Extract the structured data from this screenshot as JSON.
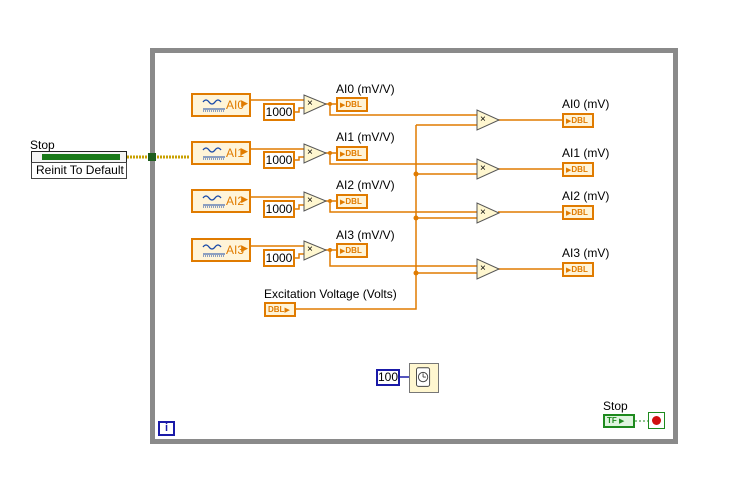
{
  "stop_control": {
    "label": "Stop",
    "reinit_label": "Reinit To Default"
  },
  "channels": [
    {
      "name": "AI0",
      "multiplier": "1000",
      "mv_per_v_label": "AI0 (mV/V)",
      "mv_label": "AI0 (mV)"
    },
    {
      "name": "AI1",
      "multiplier": "1000",
      "mv_per_v_label": "AI1 (mV/V)",
      "mv_label": "AI1 (mV)"
    },
    {
      "name": "AI2",
      "multiplier": "1000",
      "mv_per_v_label": "AI2 (mV/V)",
      "mv_label": "AI2 (mV)"
    },
    {
      "name": "AI3",
      "multiplier": "1000",
      "mv_per_v_label": "AI3 (mV/V)",
      "mv_label": "AI3 (mV)"
    }
  ],
  "excitation": {
    "label": "Excitation Voltage (Volts)"
  },
  "indicator_type": "DBL",
  "operator_symbol": "×",
  "wait": {
    "ms_value": "100"
  },
  "stop_indicator": {
    "label": "Stop",
    "type": "TF"
  },
  "loop": {
    "iteration_symbol": "i"
  },
  "colors": {
    "numeric_wire": "#e07b00",
    "boolean_wire": "#1e8a1e",
    "loop_border": "#8a8a8a",
    "integer_wire": "#1a1aa8"
  }
}
